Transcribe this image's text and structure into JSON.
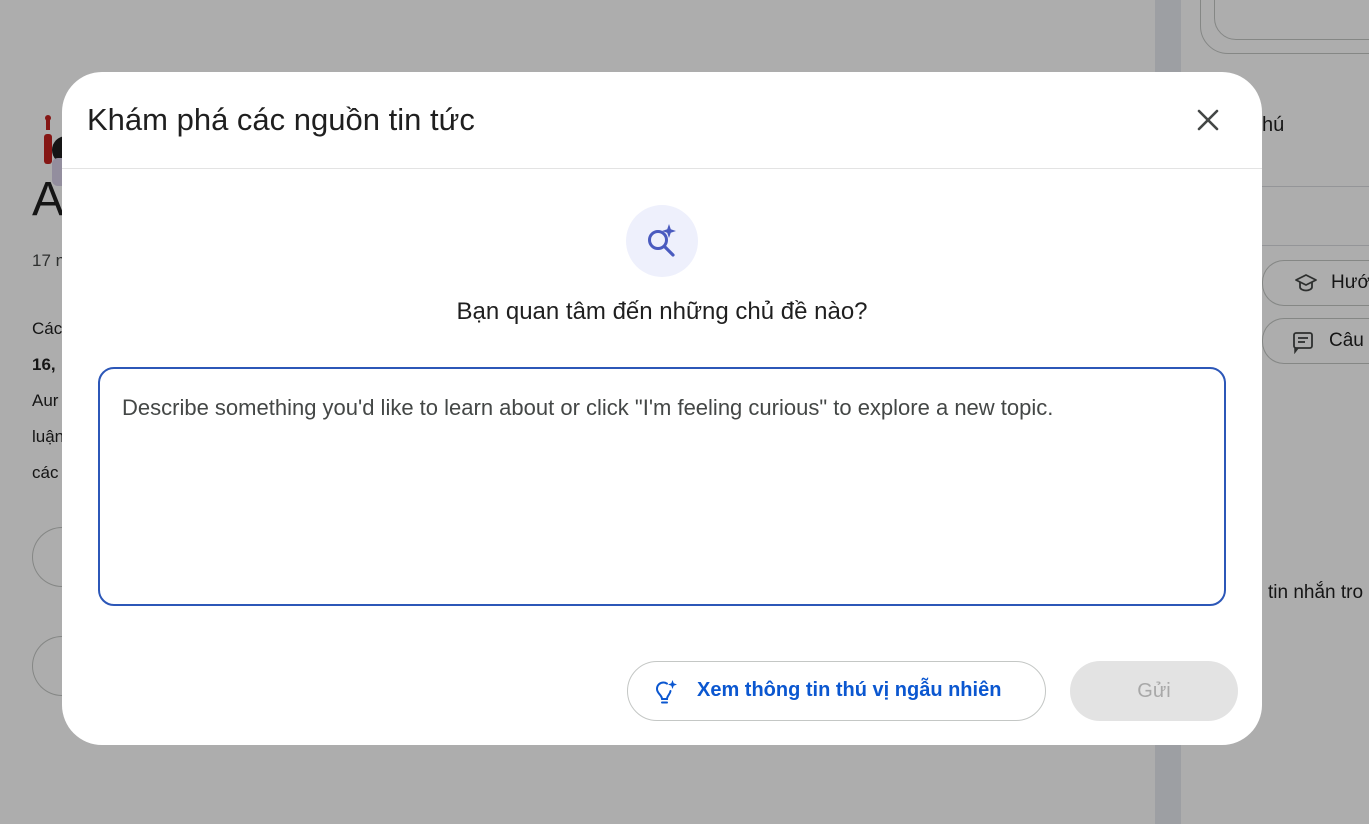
{
  "background": {
    "title_fragment": "A",
    "date_fragment": "17 n",
    "lines": [
      "Các",
      "16,",
      "Aur",
      "luận",
      "các"
    ],
    "right_panel": {
      "label_fragment": "hú",
      "button_1_label": "Hướ",
      "button_2_label": "Câu",
      "message_fragment": "tin nhắn tro"
    }
  },
  "dialog": {
    "title": "Khám phá các nguồn tin tức",
    "question": "Bạn quan tâm đến những chủ đề nào?",
    "input_placeholder": "Describe something you'd like to learn about or click \"I'm feeling curious\" to explore a new topic.",
    "input_value": "",
    "curious_button_label": "Xem thông tin thú vị ngẫu nhiên",
    "send_button_label": "Gửi"
  },
  "colors": {
    "accent": "#0b57d0",
    "input_border": "#2c57b8",
    "badge_bg": "#eef0fc",
    "disabled_bg": "#e3e3e3",
    "disabled_text": "#a8a8a8"
  },
  "icons": {
    "close": "close-icon",
    "badge": "search-spark-icon",
    "curious": "lightbulb-spark-icon"
  }
}
